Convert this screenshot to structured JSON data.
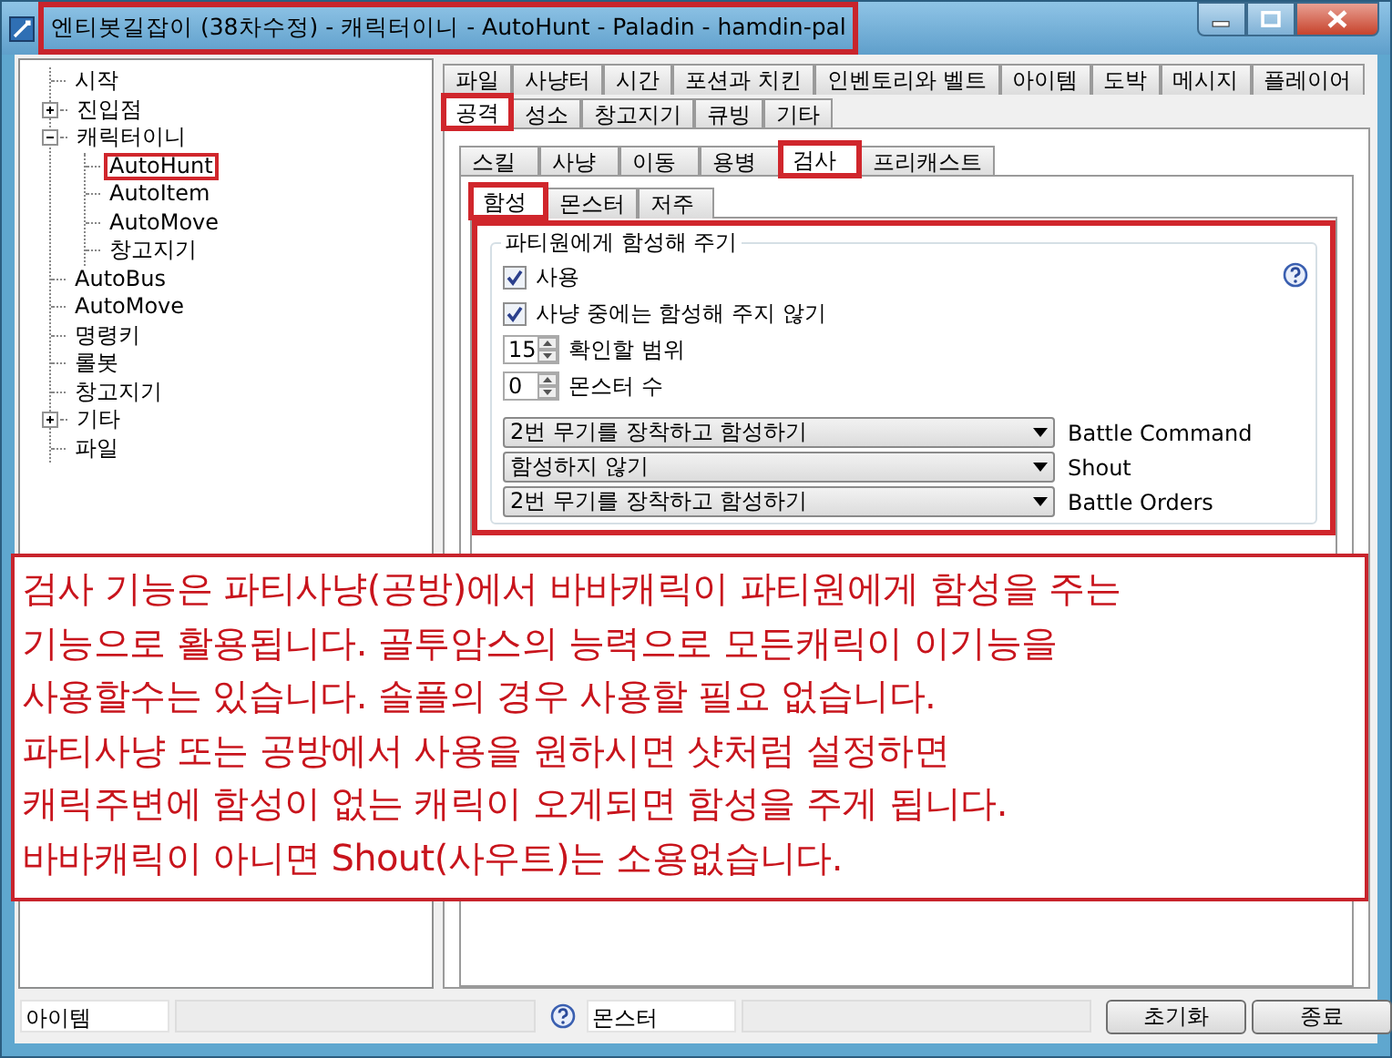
{
  "window": {
    "title": "엔티봇길잡이 (38차수정) - 캐릭터이니 - AutoHunt - Paladin - hamdin-pal",
    "highlighted": true
  },
  "tree": {
    "items": [
      {
        "label": "시작",
        "kind": "leaf",
        "selected": false
      },
      {
        "label": "진입점",
        "kind": "folder",
        "expanded": false,
        "selected": false
      },
      {
        "label": "캐릭터이니",
        "kind": "folder",
        "expanded": true,
        "selected": false,
        "children": [
          {
            "label": "AutoHunt",
            "kind": "leaf",
            "selected": true
          },
          {
            "label": "AutoItem",
            "kind": "leaf",
            "selected": false
          },
          {
            "label": "AutoMove",
            "kind": "leaf",
            "selected": false
          },
          {
            "label": "창고지기",
            "kind": "leaf",
            "selected": false
          }
        ]
      },
      {
        "label": "AutoBus",
        "kind": "leaf",
        "selected": false
      },
      {
        "label": "AutoMove",
        "kind": "leaf",
        "selected": false
      },
      {
        "label": "명령키",
        "kind": "leaf",
        "selected": false
      },
      {
        "label": "롤봇",
        "kind": "leaf",
        "selected": false
      },
      {
        "label": "창고지기",
        "kind": "leaf",
        "selected": false
      },
      {
        "label": "기타",
        "kind": "folder",
        "expanded": false,
        "selected": false
      },
      {
        "label": "파일",
        "kind": "leaf",
        "selected": false
      }
    ]
  },
  "main_tabs": {
    "rows": [
      [
        {
          "label": "파일",
          "selected": false
        },
        {
          "label": "사냥터",
          "selected": false
        },
        {
          "label": "시간",
          "selected": false
        },
        {
          "label": "포션과 치킨",
          "selected": false
        },
        {
          "label": "인벤토리와 벨트",
          "selected": false
        },
        {
          "label": "아이템",
          "selected": false
        },
        {
          "label": "도박",
          "selected": false
        },
        {
          "label": "메시지",
          "selected": false
        },
        {
          "label": "플레이어",
          "selected": false
        }
      ],
      [
        {
          "label": "공격",
          "selected": true
        },
        {
          "label": "성소",
          "selected": false
        },
        {
          "label": "창고지기",
          "selected": false
        },
        {
          "label": "큐빙",
          "selected": false
        },
        {
          "label": "기타",
          "selected": false
        }
      ]
    ]
  },
  "sub_tabs": [
    {
      "label": "스킬",
      "selected": false
    },
    {
      "label": "사냥",
      "selected": false
    },
    {
      "label": "이동",
      "selected": false
    },
    {
      "label": "용병",
      "selected": false
    },
    {
      "label": "검사",
      "selected": true
    },
    {
      "label": "프리캐스트",
      "selected": false
    }
  ],
  "inner_tabs": [
    {
      "label": "함성",
      "selected": true
    },
    {
      "label": "몬스터",
      "selected": false
    },
    {
      "label": "저주",
      "selected": false
    }
  ],
  "group": {
    "title": "파티원에게 함성해 주기",
    "highlighted": true,
    "checkboxes": [
      {
        "label": "사용",
        "checked": true
      },
      {
        "label": "사냥 중에는 함성해 주지 않기",
        "checked": true
      }
    ],
    "spinners": [
      {
        "value": "15",
        "label": "확인할 범위"
      },
      {
        "value": "0",
        "label": "몬스터 수"
      }
    ],
    "dropdowns": [
      {
        "value": "2번 무기를 장착하고 함성하기",
        "label": "Battle Command"
      },
      {
        "value": "함성하지 않기",
        "label": "Shout"
      },
      {
        "value": "2번 무기를 장착하고 함성하기",
        "label": "Battle Orders"
      }
    ]
  },
  "note": {
    "lines": [
      "검사 기능은 파티사냥(공방)에서 바바캐릭이 파티원에게 함성을 주는",
      "기능으로 활용됩니다. 골투암스의 능력으로 모든캐릭이 이기능을",
      "사용할수는 있습니다. 솔플의 경우 사용할 필요 없습니다.",
      "파티사냥 또는 공방에서 사용을 원하시면 샷처럼 설정하면",
      "캐릭주변에 함성이 없는 캐릭이 오게되면 함성을 주게 됩니다.",
      "바바캐릭이 아니면 Shout(사우트)는 소용없습니다."
    ]
  },
  "status_bar": {
    "item_field": "아이템",
    "monster_field": "몬스터",
    "buttons": [
      "초기화",
      "종료"
    ]
  }
}
